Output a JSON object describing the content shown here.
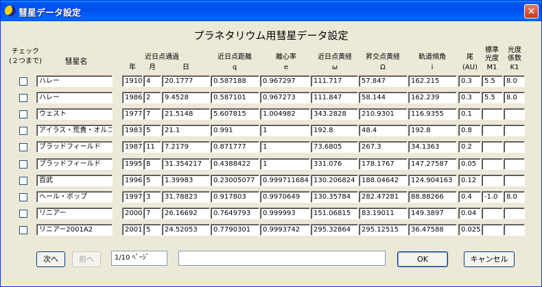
{
  "window": {
    "title": "彗星データ設定",
    "close_label": "✕"
  },
  "heading": "プラネタリウム用彗星データ設定",
  "headers": {
    "check": "チェック",
    "check_sub": "(２つまで)",
    "name": "彗星名",
    "perihelion_passage": "近日点通過",
    "year": "年",
    "month": "月",
    "day": "日",
    "q_title": "近日点距離",
    "q": "q",
    "e_title": "離心率",
    "e": "e",
    "omega_title": "近日点黄経",
    "omega": "ω",
    "node_title": "昇交点黄経",
    "node": "Ω",
    "incl_title": "軌道傾角",
    "incl": "i",
    "tail_title": "尾",
    "tail_unit": "(AU)",
    "m1_title1": "標準",
    "m1_title2": "光度",
    "m1": "M1",
    "k1_title1": "光度",
    "k1_title2": "係数",
    "k1": "K1"
  },
  "rows": [
    {
      "name": "ハレー",
      "year": "1910",
      "month": "4",
      "day": "20.1777",
      "q": "0.587188",
      "e": "0.967297",
      "omega": "111.717",
      "node": "57.847",
      "i": "162.215",
      "tail": "0.3",
      "m1": "5.5",
      "k1": "8.0"
    },
    {
      "name": "ハレー",
      "year": "1986",
      "month": "2",
      "day": "9.4528",
      "q": "0.587101",
      "e": "0.967273",
      "omega": "111.847",
      "node": "58.144",
      "i": "162.239",
      "tail": "0.3",
      "m1": "5.5",
      "k1": "8.0"
    },
    {
      "name": "ウェスト",
      "year": "1977",
      "month": "7",
      "day": "21.5148",
      "q": "5.607815",
      "e": "1.004982",
      "omega": "343.2828",
      "node": "210.9301",
      "i": "116.9355",
      "tail": "0.1",
      "m1": "",
      "k1": ""
    },
    {
      "name": "アイラス・荒貴・オルコック",
      "year": "1983",
      "month": "5",
      "day": "21.1",
      "q": "0.991",
      "e": "1",
      "omega": "192.8",
      "node": "48.4",
      "i": "192.8",
      "tail": "0.8",
      "m1": "",
      "k1": ""
    },
    {
      "name": "ブラッドフィールド",
      "year": "1987",
      "month": "11",
      "day": "7.2179",
      "q": "0.871777",
      "e": "1",
      "omega": "73.6805",
      "node": "267.3",
      "i": "34.1363",
      "tail": "0.2",
      "m1": "",
      "k1": ""
    },
    {
      "name": "ブラッドフィールド",
      "year": "1995",
      "month": "8",
      "day": "31.354217",
      "q": "0.4388422",
      "e": "1",
      "omega": "331.076",
      "node": "178.1767",
      "i": "147.27587",
      "tail": "0.05",
      "m1": "",
      "k1": ""
    },
    {
      "name": "百武",
      "year": "1996",
      "month": "5",
      "day": "1.39983",
      "q": "0.23005077",
      "e": "0.999711684",
      "omega": "130.206824",
      "node": "188.04642",
      "i": "124.904163",
      "tail": "0.12",
      "m1": "",
      "k1": ""
    },
    {
      "name": "ヘール・ボップ",
      "year": "1997",
      "month": "3",
      "day": "31.78823",
      "q": "0.917803",
      "e": "0.9970649",
      "omega": "130.35784",
      "node": "282.47281",
      "i": "88.88266",
      "tail": "0.4",
      "m1": "-1.0",
      "k1": "8.0"
    },
    {
      "name": "リニアー",
      "year": "2000",
      "month": "7",
      "day": "26.16692",
      "q": "0.7649793",
      "e": "0.999993",
      "omega": "151.06815",
      "node": "83.19011",
      "i": "149.3897",
      "tail": "0.04",
      "m1": "",
      "k1": ""
    },
    {
      "name": "リニアー2001A2",
      "year": "2001",
      "month": "5",
      "day": "24.52053",
      "q": "0.7790301",
      "e": "0.9993742",
      "omega": "295.32864",
      "node": "295.12515",
      "i": "36.47588",
      "tail": "0.025",
      "m1": "",
      "k1": ""
    }
  ],
  "footer": {
    "next_label": "次へ",
    "prev_label": "前へ",
    "page_value": "1/10 ﾍﾟｰｼﾞ",
    "comment_value": "",
    "ok_label": "OK",
    "cancel_label": "キャンセル"
  }
}
